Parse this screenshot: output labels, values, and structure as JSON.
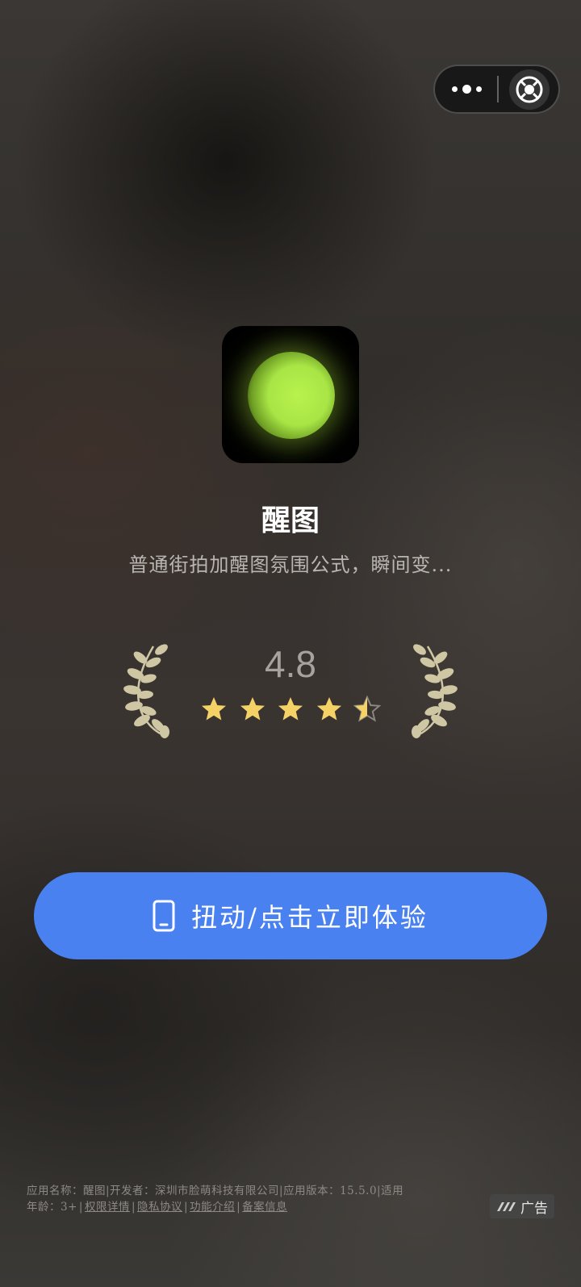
{
  "capsule": {
    "more_icon": "more-dots-icon",
    "close_icon": "target-close-icon"
  },
  "app": {
    "icon": "green-glowing-orb-app-icon",
    "name": "醒图",
    "description": "普通街拍加醒图氛围公式，瞬间变..."
  },
  "rating": {
    "score": "4.8",
    "stars": 4.5,
    "max_stars": 5,
    "star_color": "#f5d266",
    "laurel_color": "#cfc7a4"
  },
  "cta": {
    "icon": "phone-icon",
    "label": "扭动/点击立即体验",
    "color": "#4a81f0"
  },
  "footer": {
    "line1_text": "应用名称：醒图|开发者：深圳市脸萌科技有限公司|应用版本：15.5.0|适用",
    "age_text": "年龄：3+",
    "separator": "|",
    "links": [
      "权限详情",
      "隐私协议",
      "功能介绍",
      "备案信息"
    ]
  },
  "ad_badge": {
    "icon": "ad-logo-icon",
    "label": "广告"
  }
}
